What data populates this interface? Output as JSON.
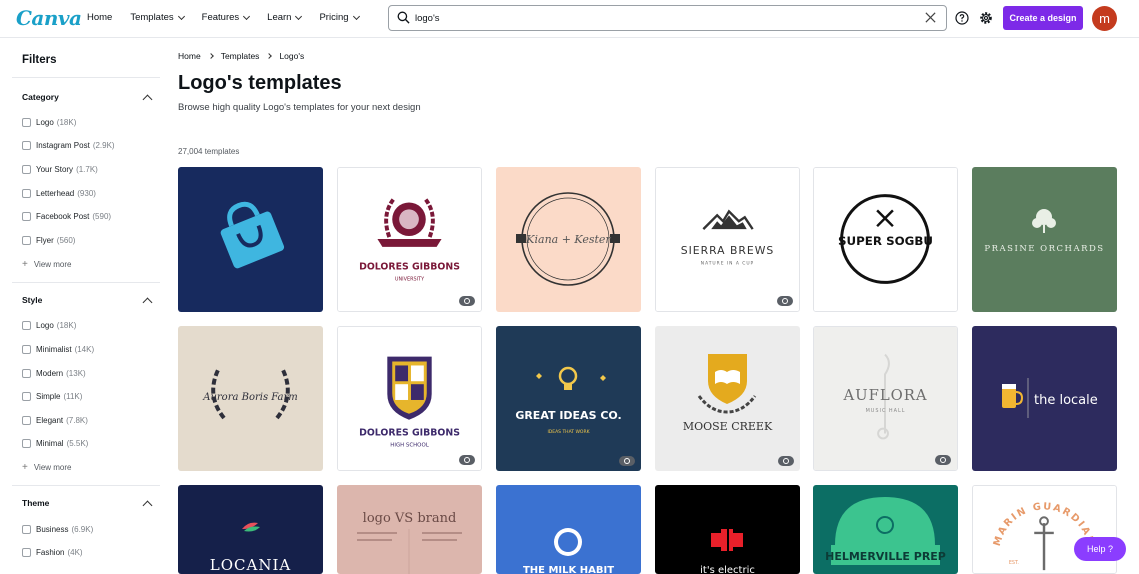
{
  "header": {
    "logo": "Canva",
    "nav": [
      {
        "label": "Home",
        "has_menu": false
      },
      {
        "label": "Templates",
        "has_menu": true
      },
      {
        "label": "Features",
        "has_menu": true
      },
      {
        "label": "Learn",
        "has_menu": true
      },
      {
        "label": "Pricing",
        "has_menu": true
      }
    ],
    "search_value": "logo's",
    "create_label": "Create a design",
    "avatar_letter": "m",
    "accent": "#7d2ae8"
  },
  "sidebar": {
    "title": "Filters",
    "sections": [
      {
        "title": "Category",
        "options": [
          {
            "label": "Logo",
            "count": "(18K)"
          },
          {
            "label": "Instagram Post",
            "count": "(2.9K)"
          },
          {
            "label": "Your Story",
            "count": "(1.7K)"
          },
          {
            "label": "Letterhead",
            "count": "(930)"
          },
          {
            "label": "Facebook Post",
            "count": "(590)"
          },
          {
            "label": "Flyer",
            "count": "(560)"
          }
        ],
        "view_more": "View more"
      },
      {
        "title": "Style",
        "options": [
          {
            "label": "Logo",
            "count": "(18K)"
          },
          {
            "label": "Minimalist",
            "count": "(14K)"
          },
          {
            "label": "Modern",
            "count": "(13K)"
          },
          {
            "label": "Simple",
            "count": "(11K)"
          },
          {
            "label": "Elegant",
            "count": "(7.8K)"
          },
          {
            "label": "Minimal",
            "count": "(5.5K)"
          }
        ],
        "view_more": "View more"
      },
      {
        "title": "Theme",
        "options": [
          {
            "label": "Business",
            "count": "(6.9K)"
          },
          {
            "label": "Fashion",
            "count": "(4K)"
          }
        ]
      }
    ]
  },
  "main": {
    "breadcrumb": [
      "Home",
      "Templates",
      "Logo's"
    ],
    "title": "Logo's templates",
    "subtitle": "Browse high quality Logo's templates for your next design",
    "count": "27,004 templates",
    "templates": [
      {
        "text": "",
        "bg": "#172a5e",
        "pro": false
      },
      {
        "text": "DOLORES GIBBONS",
        "sub": "UNIVERSITY",
        "bg": "#ffffff",
        "pro": true
      },
      {
        "text": "Kiana + Kester",
        "bg": "#fbdac8",
        "pro": false
      },
      {
        "text": "SIERRA BREWS",
        "sub": "NATURE IN A CUP",
        "bg": "#ffffff",
        "pro": true
      },
      {
        "text": "SUPER SOGBU",
        "bg": "#ffffff",
        "pro": false
      },
      {
        "text": "PRASINE ORCHARDS",
        "bg": "#5b7d5e",
        "pro": false
      },
      {
        "text": "Aurora Boris Farm",
        "bg": "#e4dbcd",
        "pro": false
      },
      {
        "text": "DOLORES GIBBONS",
        "sub": "HIGH SCHOOL",
        "bg": "#ffffff",
        "pro": true
      },
      {
        "text": "GREAT IDEAS CO.",
        "sub": "IDEAS THAT WORK",
        "bg": "#1f3a57",
        "pro": true
      },
      {
        "text": "MOOSE CREEK",
        "bg": "#ececec",
        "pro": true
      },
      {
        "text": "AUFLORA",
        "sub": "MUSIC HALL",
        "bg": "#efefed",
        "pro": true
      },
      {
        "text": "the locale",
        "bg": "#2d2b5e",
        "pro": false
      },
      {
        "text": "LOCANIA",
        "bg": "#15204a",
        "pro": false
      },
      {
        "text": "logo VS brand",
        "bg": "#dcb6ad",
        "pro": false
      },
      {
        "text": "THE MILK HABIT",
        "bg": "#3b72d1",
        "pro": false
      },
      {
        "text": "it's electric",
        "bg": "#000000",
        "pro": false
      },
      {
        "text": "HELMERVILLE PREP",
        "bg": "#0c6e64",
        "pro": false
      },
      {
        "text": "MARIN GUARDIAN",
        "sub": "EST.",
        "bg": "#ffffff",
        "pro": false
      }
    ]
  },
  "help_label": "Help ?"
}
